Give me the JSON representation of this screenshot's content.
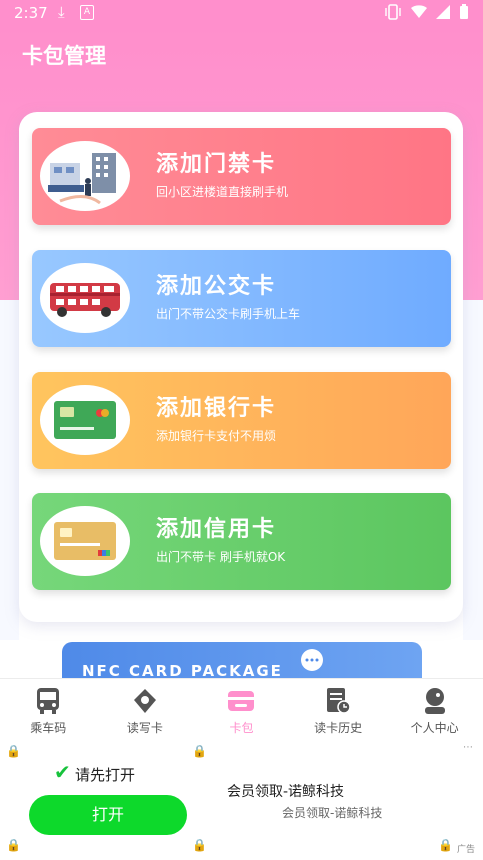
{
  "status_bar": {
    "time": "2:37",
    "download_icon": "download-icon",
    "a_icon": "A"
  },
  "header": {
    "title": "卡包管理"
  },
  "cards": [
    {
      "title": "添加门禁卡",
      "subtitle": "回小区进楼道直接刷手机",
      "color": "#ff7c8a",
      "icon": "building-illustration"
    },
    {
      "title": "添加公交卡",
      "subtitle": "出门不带公交卡刷手机上车",
      "color": "#7fb6ff",
      "icon": "bus-illustration"
    },
    {
      "title": "添加银行卡",
      "subtitle": "添加银行卡支付不用烦",
      "color": "#ffb25c",
      "icon": "bank-card-illustration"
    },
    {
      "title": "添加信用卡",
      "subtitle": "出门不带卡 刷手机就OK",
      "color": "#66cc6a",
      "icon": "credit-card-illustration"
    }
  ],
  "banner": {
    "text": "NFC CARD PACKAGE"
  },
  "nav": [
    {
      "label": "乘车码",
      "icon": "bus-icon"
    },
    {
      "label": "读写卡",
      "icon": "nfc-tag-icon"
    },
    {
      "label": "卡包",
      "icon": "wallet-icon",
      "active": true
    },
    {
      "label": "读卡历史",
      "icon": "history-icon"
    },
    {
      "label": "个人中心",
      "icon": "user-icon"
    }
  ],
  "ad": {
    "prompt": "请先打开",
    "button": "打开",
    "title": "会员领取-诺鲸科技",
    "subtitle": "会员领取-诺鲸科技",
    "tag": "广告"
  },
  "colors": {
    "accent": "#ff8fcc",
    "nav_active": "#ff8fcc",
    "ad_button": "#0dd92b"
  }
}
